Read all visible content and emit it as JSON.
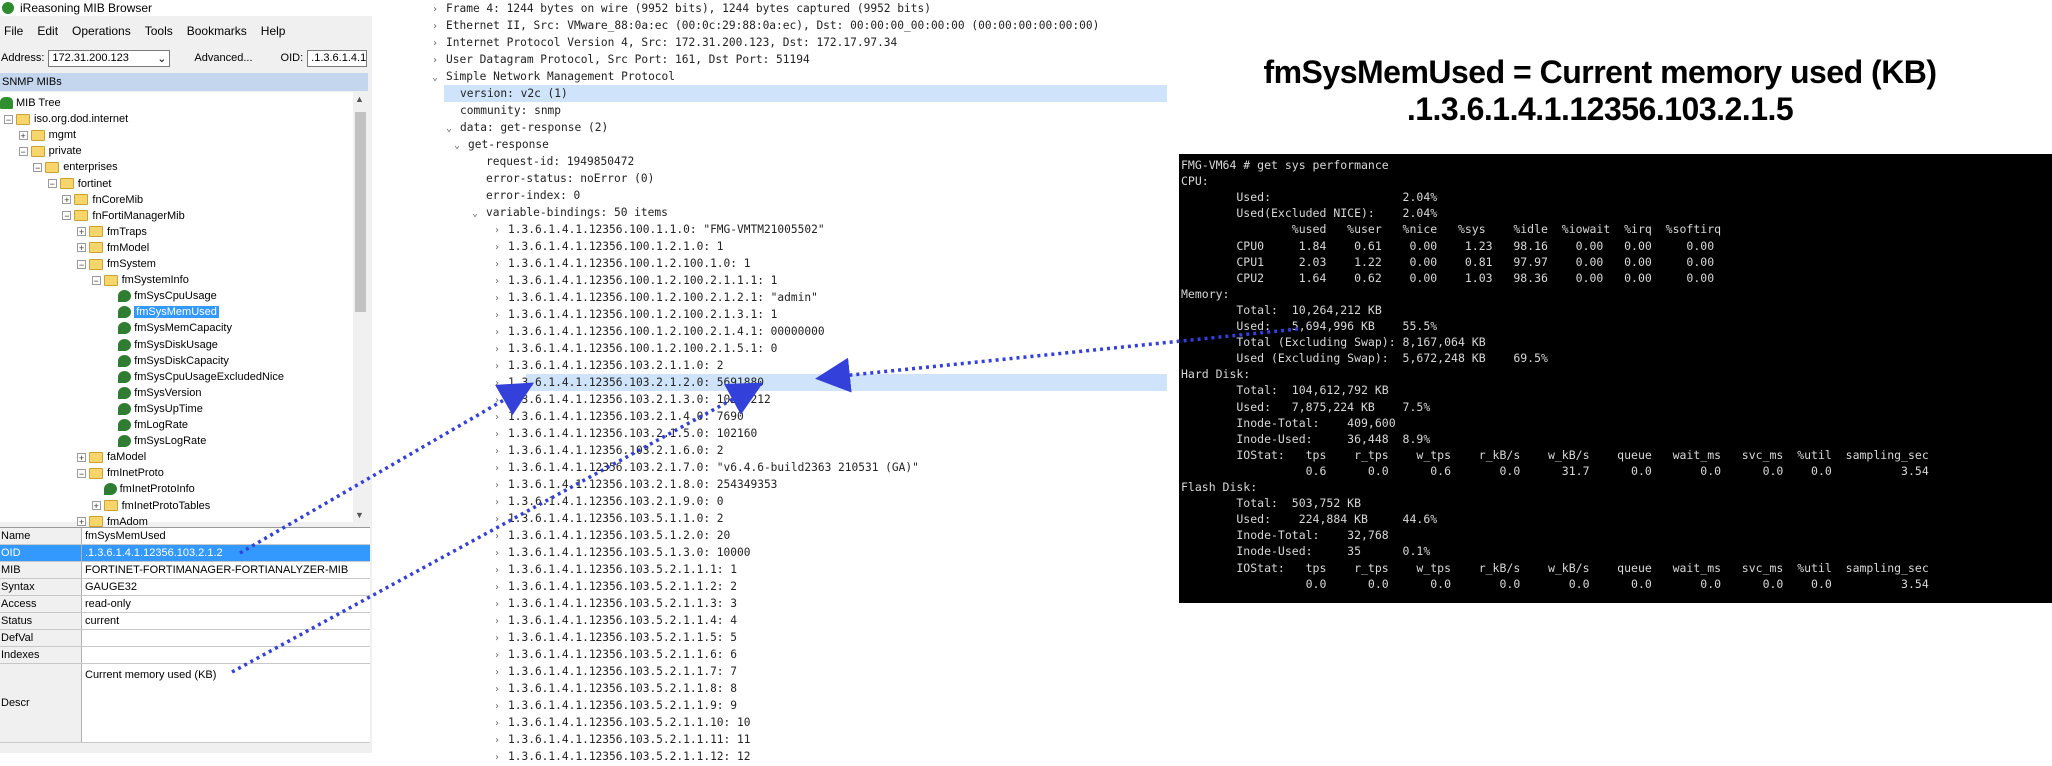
{
  "mib_browser": {
    "title": "iReasoning MIB Browser",
    "menu": [
      "File",
      "Edit",
      "Operations",
      "Tools",
      "Bookmarks",
      "Help"
    ],
    "address_label": "Address:",
    "address_value": "172.31.200.123",
    "advanced_label": "Advanced...",
    "oid_label": "OID:",
    "oid_value": ".1.3.6.1.4.1",
    "panel_title": "SNMP MIBs",
    "tree": [
      {
        "label": "MIB Tree",
        "depth": 0,
        "kind": "root"
      },
      {
        "label": "iso.org.dod.internet",
        "depth": 0,
        "kind": "folder",
        "exp": "-"
      },
      {
        "label": "mgmt",
        "depth": 1,
        "kind": "folder",
        "exp": "+"
      },
      {
        "label": "private",
        "depth": 1,
        "kind": "folder",
        "exp": "-"
      },
      {
        "label": "enterprises",
        "depth": 2,
        "kind": "folder",
        "exp": "-"
      },
      {
        "label": "fortinet",
        "depth": 3,
        "kind": "folder",
        "exp": "-"
      },
      {
        "label": "fnCoreMib",
        "depth": 4,
        "kind": "folder",
        "exp": "+"
      },
      {
        "label": "fnFortiManagerMib",
        "depth": 4,
        "kind": "folder",
        "exp": "-"
      },
      {
        "label": "fmTraps",
        "depth": 5,
        "kind": "folder",
        "exp": "+"
      },
      {
        "label": "fmModel",
        "depth": 5,
        "kind": "folder",
        "exp": "+"
      },
      {
        "label": "fmSystem",
        "depth": 5,
        "kind": "folder",
        "exp": "-"
      },
      {
        "label": "fmSystemInfo",
        "depth": 6,
        "kind": "folder",
        "exp": "-"
      },
      {
        "label": "fmSysCpuUsage",
        "depth": 7,
        "kind": "leaf"
      },
      {
        "label": "fmSysMemUsed",
        "depth": 7,
        "kind": "leaf",
        "selected": true
      },
      {
        "label": "fmSysMemCapacity",
        "depth": 7,
        "kind": "leaf"
      },
      {
        "label": "fmSysDiskUsage",
        "depth": 7,
        "kind": "leaf"
      },
      {
        "label": "fmSysDiskCapacity",
        "depth": 7,
        "kind": "leaf"
      },
      {
        "label": "fmSysCpuUsageExcludedNice",
        "depth": 7,
        "kind": "leaf"
      },
      {
        "label": "fmSysVersion",
        "depth": 7,
        "kind": "leaf"
      },
      {
        "label": "fmSysUpTime",
        "depth": 7,
        "kind": "leaf"
      },
      {
        "label": "fmLogRate",
        "depth": 7,
        "kind": "leaf"
      },
      {
        "label": "fmSysLogRate",
        "depth": 7,
        "kind": "leaf"
      },
      {
        "label": "faModel",
        "depth": 5,
        "kind": "folder",
        "exp": "+"
      },
      {
        "label": "fmInetProto",
        "depth": 5,
        "kind": "folder",
        "exp": "-"
      },
      {
        "label": "fmInetProtoInfo",
        "depth": 6,
        "kind": "leaf"
      },
      {
        "label": "fmInetProtoTables",
        "depth": 6,
        "kind": "folder",
        "exp": "+"
      },
      {
        "label": "fmAdom",
        "depth": 5,
        "kind": "folder",
        "exp": "+"
      }
    ],
    "properties": [
      {
        "key": "Name",
        "value": "fmSysMemUsed"
      },
      {
        "key": "OID",
        "value": ".1.3.6.1.4.1.12356.103.2.1.2",
        "highlight": true
      },
      {
        "key": "MIB",
        "value": "FORTINET-FORTIMANAGER-FORTIANALYZER-MIB"
      },
      {
        "key": "Syntax",
        "value": "GAUGE32"
      },
      {
        "key": "Access",
        "value": "read-only"
      },
      {
        "key": "Status",
        "value": "current"
      },
      {
        "key": "DefVal",
        "value": ""
      },
      {
        "key": "Indexes",
        "value": ""
      },
      {
        "key": "Descr",
        "value": "Current memory used (KB)",
        "tall": true
      }
    ]
  },
  "packet": {
    "lines": [
      {
        "indent": 0,
        "caret": ">",
        "text": "Frame 4: 1244 bytes on wire (9952 bits), 1244 bytes captured (9952 bits)"
      },
      {
        "indent": 0,
        "caret": ">",
        "text": "Ethernet II, Src: VMware_88:0a:ec (00:0c:29:88:0a:ec), Dst: 00:00:00_00:00:00 (00:00:00:00:00:00)"
      },
      {
        "indent": 0,
        "caret": ">",
        "text": "Internet Protocol Version 4, Src: 172.31.200.123, Dst: 172.17.97.34"
      },
      {
        "indent": 0,
        "caret": ">",
        "text": "User Datagram Protocol, Src Port: 161, Dst Port: 51194"
      },
      {
        "indent": 0,
        "caret": "v",
        "text": "Simple Network Management Protocol"
      },
      {
        "indent": 1,
        "caret": "",
        "text": "version: v2c (1)",
        "highlight": true
      },
      {
        "indent": 1,
        "caret": "",
        "text": "community: snmp"
      },
      {
        "indent": 1,
        "caret": "v",
        "text": "data: get-response (2)"
      },
      {
        "indent": 2,
        "caret": "v",
        "text": "get-response"
      },
      {
        "indent": 3,
        "caret": "",
        "text": "request-id: 1949850472"
      },
      {
        "indent": 3,
        "caret": "",
        "text": "error-status: noError (0)"
      },
      {
        "indent": 3,
        "caret": "",
        "text": "error-index: 0"
      },
      {
        "indent": 3,
        "caret": "v",
        "text": "variable-bindings: 50 items"
      },
      {
        "indent": 4,
        "caret": ">",
        "text": "1.3.6.1.4.1.12356.100.1.1.0: \"FMG-VMTM21005502\""
      },
      {
        "indent": 4,
        "caret": ">",
        "text": "1.3.6.1.4.1.12356.100.1.2.1.0: 1"
      },
      {
        "indent": 4,
        "caret": ">",
        "text": "1.3.6.1.4.1.12356.100.1.2.100.1.0: 1"
      },
      {
        "indent": 4,
        "caret": ">",
        "text": "1.3.6.1.4.1.12356.100.1.2.100.2.1.1.1: 1"
      },
      {
        "indent": 4,
        "caret": ">",
        "text": "1.3.6.1.4.1.12356.100.1.2.100.2.1.2.1: \"admin\""
      },
      {
        "indent": 4,
        "caret": ">",
        "text": "1.3.6.1.4.1.12356.100.1.2.100.2.1.3.1: 1"
      },
      {
        "indent": 4,
        "caret": ">",
        "text": "1.3.6.1.4.1.12356.100.1.2.100.2.1.4.1: 00000000"
      },
      {
        "indent": 4,
        "caret": ">",
        "text": "1.3.6.1.4.1.12356.100.1.2.100.2.1.5.1: 0"
      },
      {
        "indent": 4,
        "caret": ">",
        "text": "1.3.6.1.4.1.12356.103.2.1.1.0: 2"
      },
      {
        "indent": 4,
        "caret": ">",
        "text": "1.3.6.1.4.1.12356.103.2.1.2.0: 5691880",
        "highlight": true
      },
      {
        "indent": 4,
        "caret": ">",
        "text": "1.3.6.1.4.1.12356.103.2.1.3.0: 10264212"
      },
      {
        "indent": 4,
        "caret": ">",
        "text": "1.3.6.1.4.1.12356.103.2.1.4.0: 7690"
      },
      {
        "indent": 4,
        "caret": ">",
        "text": "1.3.6.1.4.1.12356.103.2.1.5.0: 102160"
      },
      {
        "indent": 4,
        "caret": ">",
        "text": "1.3.6.1.4.1.12356.103.2.1.6.0: 2"
      },
      {
        "indent": 4,
        "caret": ">",
        "text": "1.3.6.1.4.1.12356.103.2.1.7.0: \"v6.4.6-build2363 210531 (GA)\""
      },
      {
        "indent": 4,
        "caret": ">",
        "text": "1.3.6.1.4.1.12356.103.2.1.8.0: 254349353"
      },
      {
        "indent": 4,
        "caret": ">",
        "text": "1.3.6.1.4.1.12356.103.2.1.9.0: 0"
      },
      {
        "indent": 4,
        "caret": ">",
        "text": "1.3.6.1.4.1.12356.103.5.1.1.0: 2"
      },
      {
        "indent": 4,
        "caret": ">",
        "text": "1.3.6.1.4.1.12356.103.5.1.2.0: 20"
      },
      {
        "indent": 4,
        "caret": ">",
        "text": "1.3.6.1.4.1.12356.103.5.1.3.0: 10000"
      },
      {
        "indent": 4,
        "caret": ">",
        "text": "1.3.6.1.4.1.12356.103.5.2.1.1.1: 1"
      },
      {
        "indent": 4,
        "caret": ">",
        "text": "1.3.6.1.4.1.12356.103.5.2.1.1.2: 2"
      },
      {
        "indent": 4,
        "caret": ">",
        "text": "1.3.6.1.4.1.12356.103.5.2.1.1.3: 3"
      },
      {
        "indent": 4,
        "caret": ">",
        "text": "1.3.6.1.4.1.12356.103.5.2.1.1.4: 4"
      },
      {
        "indent": 4,
        "caret": ">",
        "text": "1.3.6.1.4.1.12356.103.5.2.1.1.5: 5"
      },
      {
        "indent": 4,
        "caret": ">",
        "text": "1.3.6.1.4.1.12356.103.5.2.1.1.6: 6"
      },
      {
        "indent": 4,
        "caret": ">",
        "text": "1.3.6.1.4.1.12356.103.5.2.1.1.7: 7"
      },
      {
        "indent": 4,
        "caret": ">",
        "text": "1.3.6.1.4.1.12356.103.5.2.1.1.8: 8"
      },
      {
        "indent": 4,
        "caret": ">",
        "text": "1.3.6.1.4.1.12356.103.5.2.1.1.9: 9"
      },
      {
        "indent": 4,
        "caret": ">",
        "text": "1.3.6.1.4.1.12356.103.5.2.1.1.10: 10"
      },
      {
        "indent": 4,
        "caret": ">",
        "text": "1.3.6.1.4.1.12356.103.5.2.1.1.11: 11"
      },
      {
        "indent": 4,
        "caret": ">",
        "text": "1.3.6.1.4.1.12356.103.5.2.1.1.12: 12"
      }
    ]
  },
  "caption": {
    "line1": "fmSysMemUsed = Current memory used (KB)",
    "line2": ".1.3.6.1.4.1.12356.103.2.1.5"
  },
  "terminal": {
    "lines": [
      "FMG-VM64 # get sys performance",
      "CPU:",
      "        Used:                   2.04%",
      "        Used(Excluded NICE):    2.04%",
      "                %used   %user   %nice   %sys    %idle  %iowait  %irq  %softirq",
      "        CPU0     1.84    0.61    0.00    1.23   98.16    0.00   0.00     0.00",
      "        CPU1     2.03    1.22    0.00    0.81   97.97    0.00   0.00     0.00",
      "        CPU2     1.64    0.62    0.00    1.03   98.36    0.00   0.00     0.00",
      "Memory:",
      "        Total:  10,264,212 KB",
      "        Used:   5,694,996 KB    55.5%",
      "        Total (Excluding Swap): 8,167,064 KB",
      "        Used (Excluding Swap):  5,672,248 KB    69.5%",
      "Hard Disk:",
      "        Total:  104,612,792 KB",
      "        Used:   7,875,224 KB    7.5%",
      "        Inode-Total:    409,600",
      "        Inode-Used:     36,448  8.9%",
      "        IOStat:   tps    r_tps    w_tps    r_kB/s    w_kB/s    queue   wait_ms   svc_ms  %util  sampling_sec",
      "                  0.6      0.0      0.6       0.0      31.7      0.0       0.0      0.0    0.0          3.54",
      "Flash Disk:",
      "        Total:  503,752 KB",
      "        Used:    224,884 KB     44.6%",
      "        Inode-Total:    32,768",
      "        Inode-Used:     35      0.1%",
      "        IOStat:   tps    r_tps    w_tps    r_kB/s    w_kB/s    queue   wait_ms   svc_ms  %util  sampling_sec",
      "                  0.0      0.0      0.0       0.0       0.0      0.0       0.0      0.0    0.0          3.54"
    ]
  },
  "colors": {
    "selection": "#3399ff",
    "packet_highlight": "#cfe4fb",
    "arrow": "#3340d9",
    "terminal_bg": "#000000"
  }
}
